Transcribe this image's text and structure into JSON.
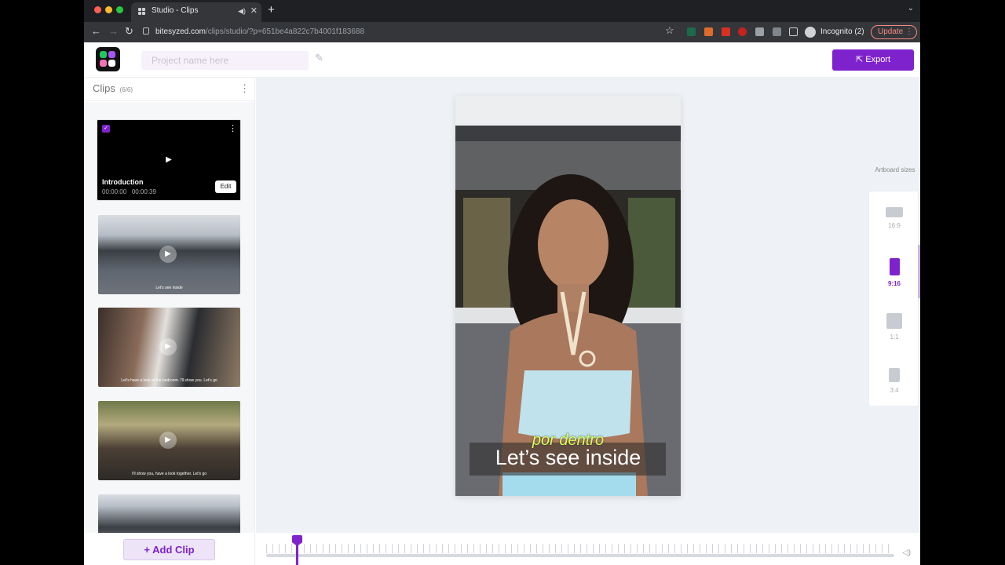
{
  "browser": {
    "tab_title": "Studio - Clips",
    "new_tab": "+",
    "url_host": "bitesyzed.com",
    "url_path": "/clips/studio/?p=651be4a822c7b4001f183688",
    "profile_label": "Incognito (2)",
    "update_label": "Update",
    "colors": {
      "update": "#f28b82"
    }
  },
  "header": {
    "project_name_placeholder": "Project name here",
    "export_label": "Export",
    "accent_color": "#7e22ce"
  },
  "sidebar": {
    "title": "Clips",
    "count": "(6/6)",
    "clips": [
      {
        "title": "Introduction",
        "time_start": "00:00:00",
        "time_end": "00:00:39",
        "edit_label": "Edit",
        "selected": true
      },
      {
        "caption": "Let's see inside"
      },
      {
        "caption": "Let's have a look at the bedroom. I'll show you. Let's go"
      },
      {
        "caption": "I'll show you, have a look together. Let's go"
      },
      {
        "caption": ""
      }
    ],
    "add_clip_label": "Add Clip"
  },
  "preview": {
    "subtitle_translation": "por dentro",
    "subtitle_main": "Let’s see inside"
  },
  "artboard": {
    "title": "Artboard sizes",
    "sizes": [
      {
        "label": "16:9",
        "selected": false
      },
      {
        "label": "9:16",
        "selected": true
      },
      {
        "label": "1:1",
        "selected": false
      },
      {
        "label": "3:4",
        "selected": false
      }
    ]
  },
  "icons": [
    "close-icon",
    "mute-icon",
    "back-icon",
    "forward-icon",
    "reload-icon",
    "star-icon",
    "extensions-icon",
    "pencil-icon",
    "export-icon",
    "more-vertical-icon",
    "play-icon",
    "plus-icon",
    "volume-icon"
  ]
}
